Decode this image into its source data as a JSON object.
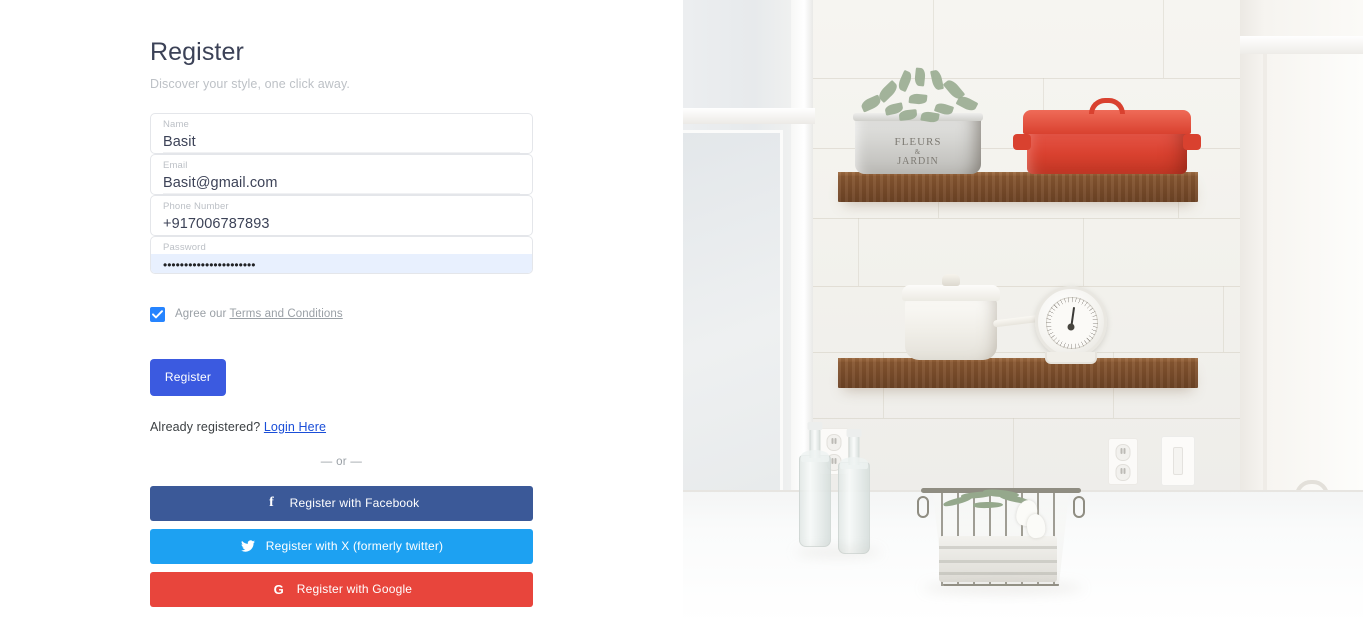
{
  "form": {
    "title": "Register",
    "subtitle": "Discover your style, one click away.",
    "fields": [
      {
        "label": "Name",
        "value": "Basit"
      },
      {
        "label": "Email",
        "value": "Basit@gmail.com"
      },
      {
        "label": "Phone Number",
        "value": "+917006787893"
      },
      {
        "label": "Password",
        "value": "••••••••••••••••••••••"
      }
    ],
    "agree": {
      "prefix": "Agree our",
      "link": "Terms and Conditions",
      "checked": true
    },
    "submit_label": "Register",
    "already": {
      "text": "Already registered?",
      "link": "Login Here"
    },
    "separator": "— or —",
    "social_buttons": [
      {
        "label": "Register with Facebook",
        "icon": "facebook-icon",
        "color": "#3b5998"
      },
      {
        "label": "Register with X (formerly twitter)",
        "icon": "twitter-icon",
        "color": "#1da1f2"
      },
      {
        "label": "Register with Google",
        "icon": "google-icon",
        "color": "#e8453c"
      }
    ]
  },
  "photo": {
    "description": "Bright white kitchen with subway tile backsplash and two wooden floating shelves",
    "planter_text_line1": "FLEURS",
    "planter_text_amp": "&",
    "planter_text_line2": "JARDIN"
  },
  "colors": {
    "primary": "#3b5ae0",
    "checkbox": "#2684ff",
    "link": "#1a4ed8",
    "muted": "#9aa0a6",
    "autofill_bg": "#e8f0fe"
  }
}
